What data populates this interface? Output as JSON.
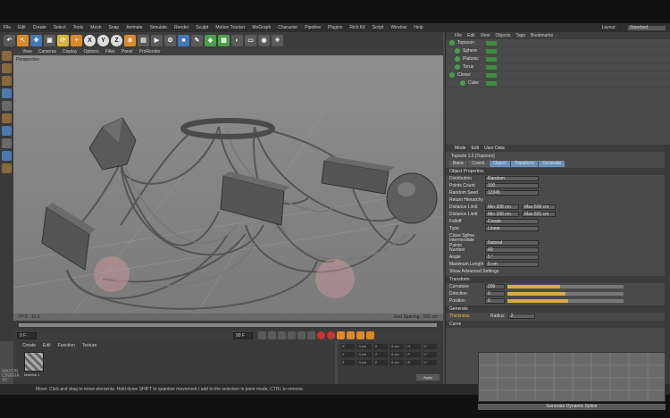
{
  "menubar": {
    "items": [
      "File",
      "Edit",
      "Create",
      "Select",
      "Tools",
      "Mesh",
      "Snap",
      "Animate",
      "Simulate",
      "Render",
      "Sculpt",
      "Motion Tracker",
      "MoGraph",
      "Character",
      "Pipeline",
      "Plugins",
      "Rich Kit",
      "Script",
      "Window",
      "Help"
    ],
    "layout_label": "Layout:",
    "layout_value": "Standard"
  },
  "toolbar": {
    "buttons": [
      "undo-icon",
      "select-icon",
      "move-icon",
      "scale-icon",
      "rotate-icon",
      "add-icon",
      "X",
      "Y",
      "Z",
      "coord-icon",
      "render-region-icon",
      "render-view-icon",
      "render-settings-icon",
      "cube-icon",
      "pen-icon",
      "subdivision-icon",
      "array-icon",
      "deformer-icon",
      "floor-icon",
      "camera-icon",
      "light-icon"
    ]
  },
  "viewport": {
    "menu": [
      "View",
      "Cameras",
      "Display",
      "Options",
      "Filter",
      "Panel",
      "ProRender"
    ],
    "label": "Perspective",
    "fps": "FPS : 10.0",
    "grid": "Grid Spacing : 100 cm"
  },
  "timeline": {
    "start": "0 F",
    "end": "90 F",
    "current": "0 F"
  },
  "material": {
    "menu": [
      "Create",
      "Edit",
      "Function",
      "Texture"
    ],
    "name": "Material 1"
  },
  "coords": {
    "rows": [
      [
        "X",
        "0 cm",
        "X",
        "0 cm",
        "H",
        "0 °"
      ],
      [
        "Y",
        "0 cm",
        "Y",
        "0 cm",
        "P",
        "0 °"
      ],
      [
        "Z",
        "0 cm",
        "Z",
        "0 cm",
        "B",
        "0 °"
      ]
    ],
    "apply": "Apply"
  },
  "status": "Move: Click and drag to move elements. Hold down SHIFT to quantize movement / add to the selection in point mode, CTRL to remove.",
  "object_manager": {
    "menu": [
      "File",
      "Edit",
      "View",
      "Objects",
      "Tags",
      "Bookmarks"
    ],
    "objects": [
      "Topsoon",
      "Sphere",
      "Platonic",
      "Torus",
      "Cloner",
      "Cube"
    ]
  },
  "attributes": {
    "menu": [
      "Mode",
      "Edit",
      "User Data"
    ],
    "title": "Topsolo 1.0 [Topsoon]",
    "tabs": [
      "Basic",
      "Coord.",
      "Object",
      "Transform",
      "Generate"
    ],
    "sections": {
      "object": "Object Properties",
      "transform": "Transform",
      "generate": "Generate",
      "curve": "Curve"
    },
    "props": [
      {
        "label": "Distribution",
        "value": "Random"
      },
      {
        "label": "Points Count",
        "value": "100"
      },
      {
        "label": "Random Seed",
        "value": "12345"
      },
      {
        "label": "Return Hierarchy",
        "value": ""
      },
      {
        "label": "Distance Limit",
        "value": "Min  208 cm",
        "value2": "Max  508 cm"
      },
      {
        "label": "Distance Limit",
        "value": "Min  100 cm",
        "value2": "Max  521 cm"
      },
      {
        "label": "Falloff",
        "value": "Create"
      },
      {
        "label": "Type",
        "value": "Linear"
      },
      {
        "label": "Close Spline",
        "value": ""
      },
      {
        "label": "Intermediate Points",
        "value": "Natural"
      },
      {
        "label": "Number",
        "value": "40"
      },
      {
        "label": "Angle",
        "value": "5 °"
      },
      {
        "label": "Maximum Length",
        "value": "5 cm"
      }
    ],
    "advanced": "Show Advanced Settings",
    "transform_props": [
      {
        "label": "Curvature",
        "value": "200",
        "pct": 45
      },
      {
        "label": "Direction",
        "value": "0",
        "pct": 50
      },
      {
        "label": "Position",
        "value": "0",
        "pct": 52
      }
    ],
    "generate_props": {
      "thickness": "Thickness",
      "radius_label": "Radius",
      "radius": "2"
    },
    "generate_button": "Generate Dynamic Spline"
  }
}
